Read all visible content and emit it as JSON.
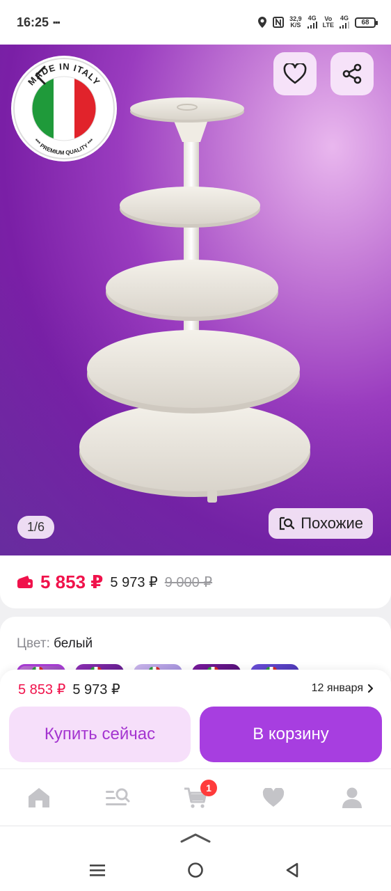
{
  "status_bar": {
    "time": "16:25",
    "notification_dots": "▪▪▪",
    "net_speed": "32,9",
    "net_speed_unit": "K/S",
    "signal_1": "4G",
    "volte": "Vo",
    "volte_sub": "LTE",
    "signal_2": "4G",
    "battery": "68"
  },
  "hero": {
    "badge_top_text": "MADE IN ITALY",
    "badge_bottom_text": "*** PREMIUM QUALITY ***",
    "image_counter": "1/6",
    "similar_label": "Похожие"
  },
  "price": {
    "main": "5 853 ₽",
    "alt": "5 973 ₽",
    "old": "9 000 ₽"
  },
  "color": {
    "label": "Цвет:",
    "value": "белый"
  },
  "buy_bar": {
    "price_main": "5 853 ₽",
    "price_alt": "5 973 ₽",
    "delivery_date": "12 января",
    "buy_now_label": "Купить сейчас",
    "add_to_cart_label": "В корзину"
  },
  "tab_bar": {
    "items": [
      "home-icon",
      "catalog-search-icon",
      "cart-icon",
      "favorites-icon",
      "profile-icon"
    ],
    "cart_badge": "1"
  },
  "colors": {
    "accent": "#a73ee0",
    "price_red": "#f0124b",
    "buy_now_bg": "#f6dffa"
  }
}
